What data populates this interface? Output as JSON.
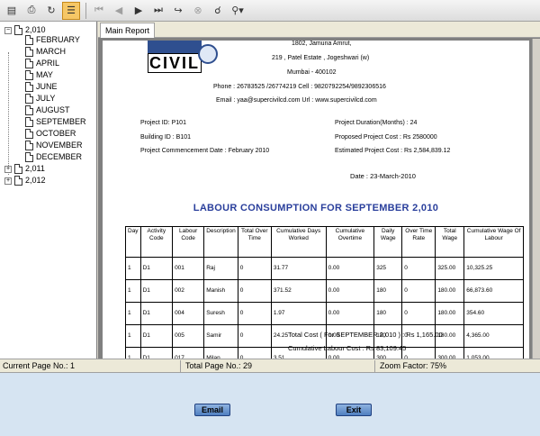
{
  "toolbar": {
    "icons": [
      "export-icon",
      "print-icon",
      "refresh-icon",
      "tree-toggle-icon",
      "first-page-icon",
      "prev-page-icon",
      "next-page-icon",
      "last-page-icon",
      "goto-page-icon",
      "stop-icon",
      "search-icon",
      "zoom-icon"
    ]
  },
  "tree": {
    "year_expanded": "2,010",
    "months": [
      "FEBRUARY",
      "MARCH",
      "APRIL",
      "MAY",
      "JUNE",
      "JULY",
      "AUGUST",
      "SEPTEMBER",
      "OCTOBER",
      "NOVEMBER",
      "DECEMBER"
    ],
    "year_2": "2,011",
    "year_3": "2,012"
  },
  "tab": {
    "label": "Main Report"
  },
  "report": {
    "logo_text": "CIVIL",
    "address1": "1802, Jamuna Amrut,",
    "address2": "219 , Patel Estate , Jogeshwari (w)",
    "address3": "Mumbai  -   400102",
    "phone": "Phone :  26783525 /26774219  Cell :    9820792254/9892306516",
    "email": "Email :    yaa@supercivilcd.com  Url :    www.supercivilcd.com",
    "project_id": "Project ID: P101",
    "building_id": "Building ID : B101",
    "commencement": "Project Commencement Date : February 2010",
    "duration": "Project Duration(Months) : 24",
    "proposed_cost": "Proposed Project Cost : Rs 2580000",
    "estimated_cost": "Estimated Project Cost : Rs 2,584,839.12",
    "date": "Date :   23-March-2010",
    "title": "LABOUR CONSUMPTION FOR SEPTEMBER  2,010",
    "total_cost": "Total Cost ( For SEPTEMBER 2,010 ) : Rs   1,165.00",
    "cumulative_cost": "Cumulative Labour Cost : Rs 83,109.45"
  },
  "table": {
    "headers": [
      "Day",
      "Activity Code",
      "Labour Code",
      "Description",
      "Total Over Time",
      "Cumulative Days Worked",
      "Cumulative Overtime",
      "Daily Wage",
      "Over Time Rate",
      "Total Wage",
      "Cumulative Wage Of Labour"
    ],
    "rows": [
      [
        "1",
        "D1",
        "001",
        "Raj",
        "0",
        "31.77",
        "0.00",
        "325",
        "0",
        "325.00",
        "10,325.25"
      ],
      [
        "1",
        "D1",
        "002",
        "Manish",
        "0",
        "371.52",
        "0.00",
        "180",
        "0",
        "180.00",
        "66,873.60"
      ],
      [
        "1",
        "D1",
        "004",
        "Suresh",
        "0",
        "1.97",
        "0.00",
        "180",
        "0",
        "180.00",
        "354.60"
      ],
      [
        "1",
        "D1",
        "005",
        "Samir",
        "0",
        "24.25",
        "0.00",
        "180",
        "0",
        "180.00",
        "4,365.00"
      ],
      [
        "1",
        "D1",
        "017",
        "Milan",
        "0",
        "3.51",
        "0.00",
        "300",
        "0",
        "300.00",
        "1,053.00"
      ]
    ]
  },
  "status": {
    "current_page": "Current Page No.: 1",
    "total_page": "Total Page No.: 29",
    "zoom": "Zoom Factor: 75%"
  },
  "buttons": {
    "email": "Email",
    "exit": "Exit"
  }
}
